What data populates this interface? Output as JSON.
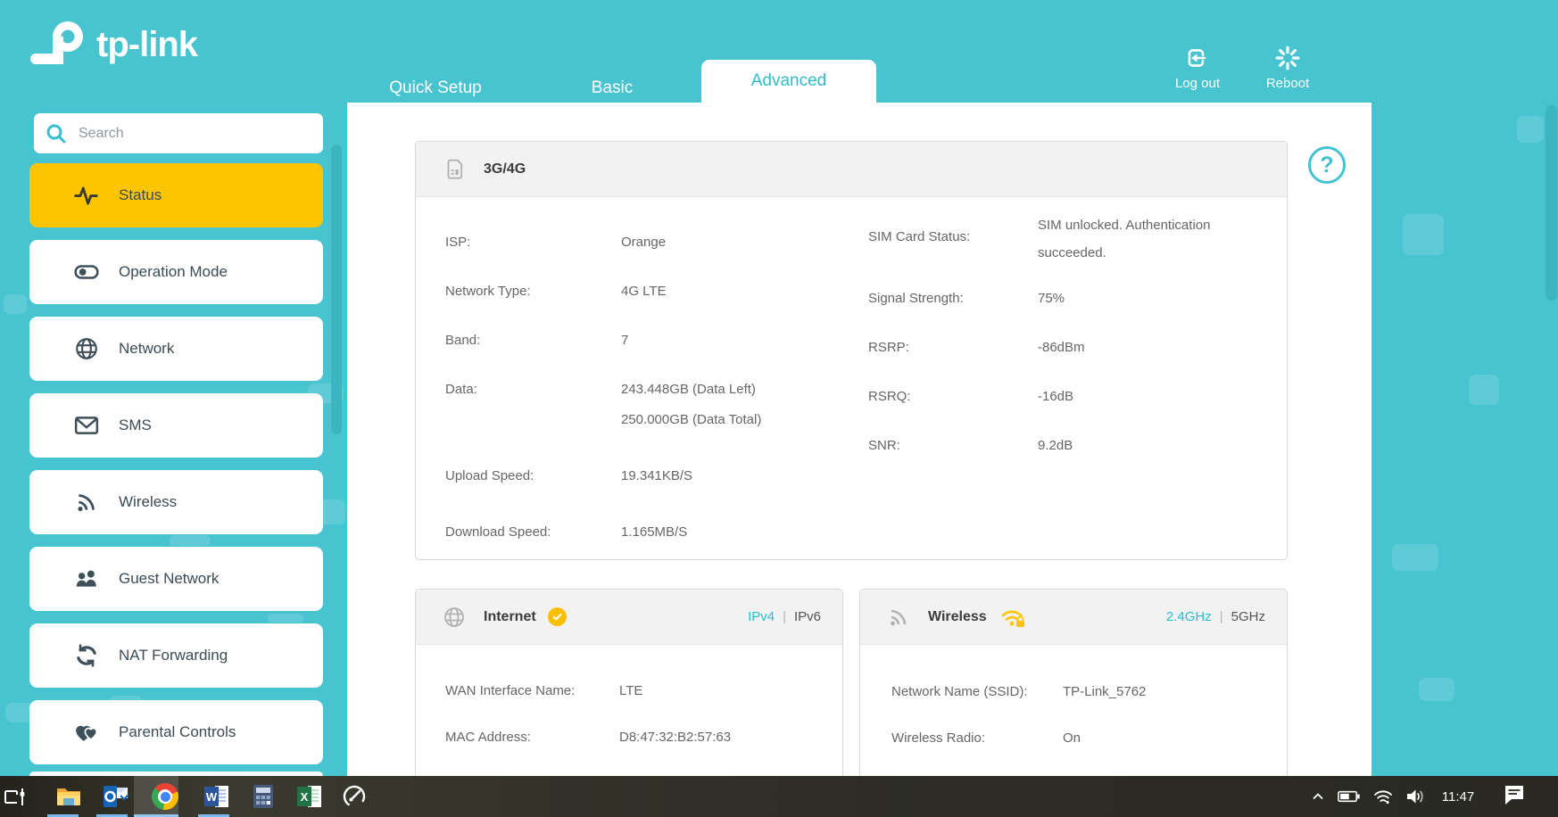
{
  "brand": {
    "logo_text": "tp-link"
  },
  "header": {
    "tabs": [
      {
        "label": "Quick Setup",
        "active": false
      },
      {
        "label": "Basic",
        "active": false
      },
      {
        "label": "Advanced",
        "active": true
      }
    ],
    "logout_label": "Log out",
    "reboot_label": "Reboot"
  },
  "sidebar": {
    "search_placeholder": "Search",
    "items": [
      {
        "label": "Status",
        "icon": "pulse-icon",
        "active": true
      },
      {
        "label": "Operation Mode",
        "icon": "toggle-icon",
        "active": false
      },
      {
        "label": "Network",
        "icon": "globe-icon",
        "active": false
      },
      {
        "label": "SMS",
        "icon": "envelope-icon",
        "active": false
      },
      {
        "label": "Wireless",
        "icon": "wifi-icon",
        "active": false
      },
      {
        "label": "Guest Network",
        "icon": "people-icon",
        "active": false
      },
      {
        "label": "NAT Forwarding",
        "icon": "sync-icon",
        "active": false
      },
      {
        "label": "Parental Controls",
        "icon": "hearts-icon",
        "active": false
      }
    ]
  },
  "panels": {
    "cellular": {
      "title": "3G/4G",
      "left": [
        {
          "label": "ISP:",
          "value": "Orange"
        },
        {
          "label": "Network Type:",
          "value": "4G LTE"
        },
        {
          "label": "Band:",
          "value": "7"
        },
        {
          "label": "Data:",
          "value": "243.448GB (Data Left)",
          "value2": "250.000GB (Data Total)"
        },
        {
          "label": "Upload Speed:",
          "value": "19.341KB/S"
        },
        {
          "label": "Download Speed:",
          "value": "1.165MB/S"
        }
      ],
      "right": [
        {
          "label": "SIM Card Status:",
          "value": "SIM unlocked. Authentication succeeded."
        },
        {
          "label": "Signal Strength:",
          "value": "75%"
        },
        {
          "label": "RSRP:",
          "value": "-86dBm"
        },
        {
          "label": "RSRQ:",
          "value": "-16dB"
        },
        {
          "label": "SNR:",
          "value": "9.2dB"
        }
      ]
    },
    "internet": {
      "title": "Internet",
      "ipv4": "IPv4",
      "separator": "|",
      "ipv6": "IPv6",
      "rows": [
        {
          "label": "WAN Interface Name:",
          "value": "LTE"
        },
        {
          "label": "MAC Address:",
          "value": "D8:47:32:B2:57:63"
        }
      ]
    },
    "wireless": {
      "title": "Wireless",
      "band1": "2.4GHz",
      "separator": "|",
      "band2": "5GHz",
      "rows": [
        {
          "label": "Network Name (SSID):",
          "value": "TP-Link_5762"
        },
        {
          "label": "Wireless Radio:",
          "value": "On"
        }
      ]
    }
  },
  "help": "?",
  "taskbar": {
    "time": "11:47"
  },
  "colors": {
    "teal_background": "#48c4d1",
    "accent_text": "#2fbdcb",
    "active_item_yellow": "#fdc500",
    "badge_yellow": "#fcbe00",
    "taskbar_underline_blue": "#76b9ed"
  }
}
